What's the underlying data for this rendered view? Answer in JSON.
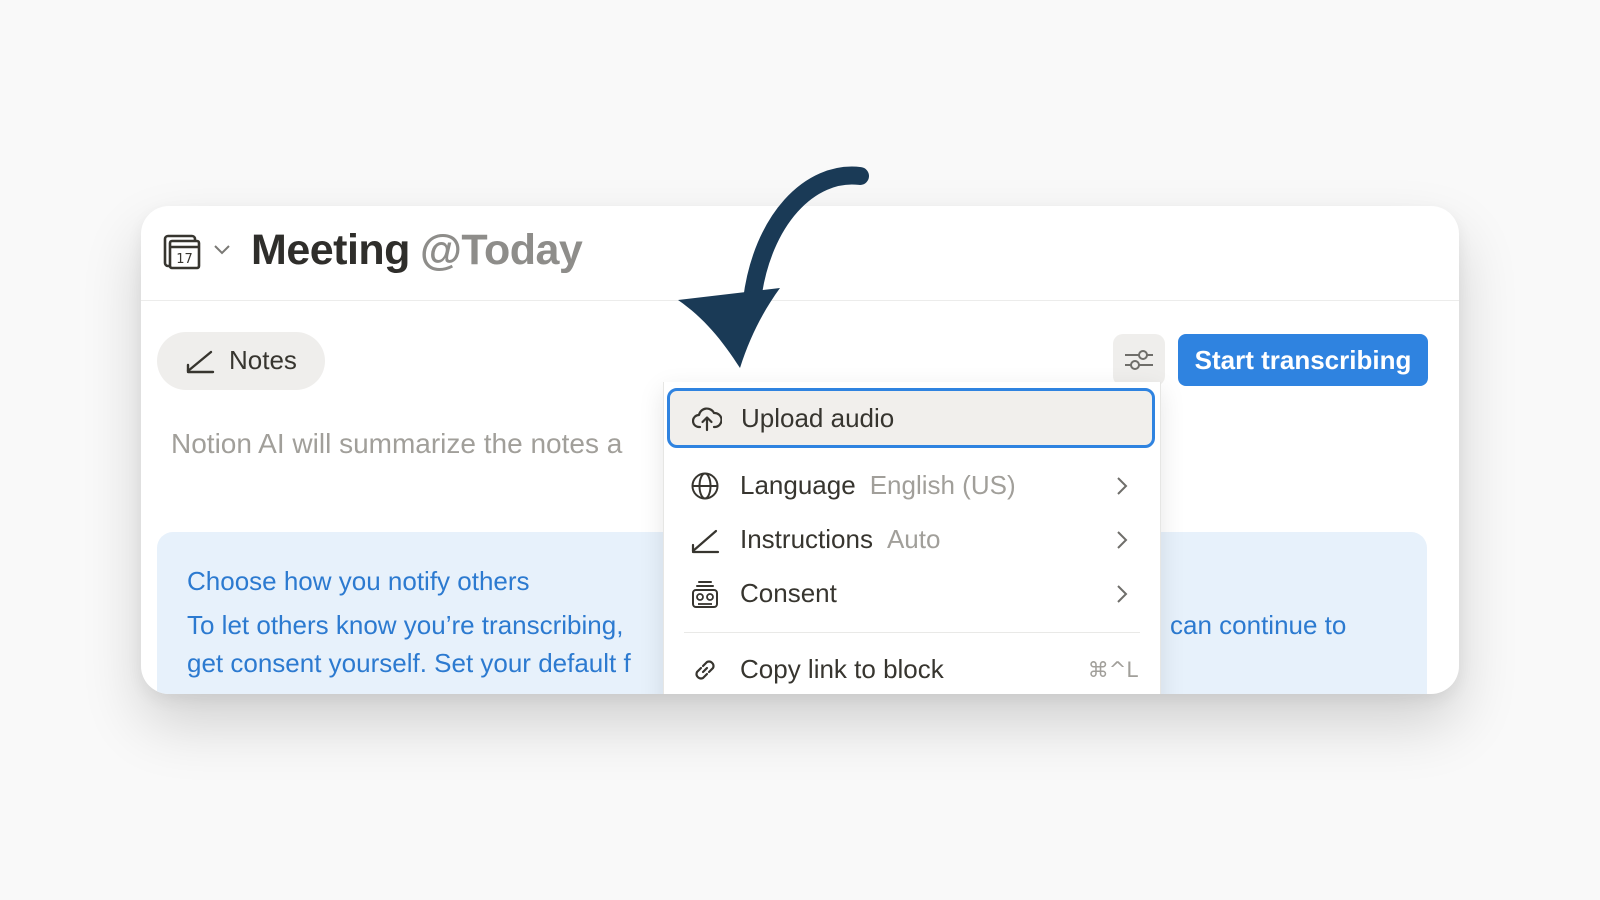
{
  "header": {
    "title": "Meeting",
    "date_mention": "@Today",
    "calendar_day": "17"
  },
  "tabs": {
    "notes_label": "Notes"
  },
  "toolbar": {
    "start_label": "Start transcribing"
  },
  "editor": {
    "placeholder": "Notion AI will summarize the notes a"
  },
  "callout": {
    "title": "Choose how you notify others",
    "line1_visible": "To let others know you’re transcribing,",
    "line2_visible": "get consent yourself. Set your default f",
    "line1_right": "can continue to"
  },
  "menu": {
    "items": [
      {
        "label": "Upload audio",
        "icon": "cloud-upload-icon"
      },
      {
        "label": "Language",
        "value": "English (US)",
        "icon": "globe-icon"
      },
      {
        "label": "Instructions",
        "value": "Auto",
        "icon": "pen-icon"
      },
      {
        "label": "Consent",
        "icon": "consent-icon"
      },
      {
        "label": "Copy link to block",
        "shortcut": "⌘^L",
        "icon": "link-icon"
      }
    ]
  },
  "colors": {
    "accent": "#2f83e0",
    "arrow": "#1a3a56",
    "callout_bg": "#e7f1fb",
    "callout_text": "#2c7ad0"
  }
}
